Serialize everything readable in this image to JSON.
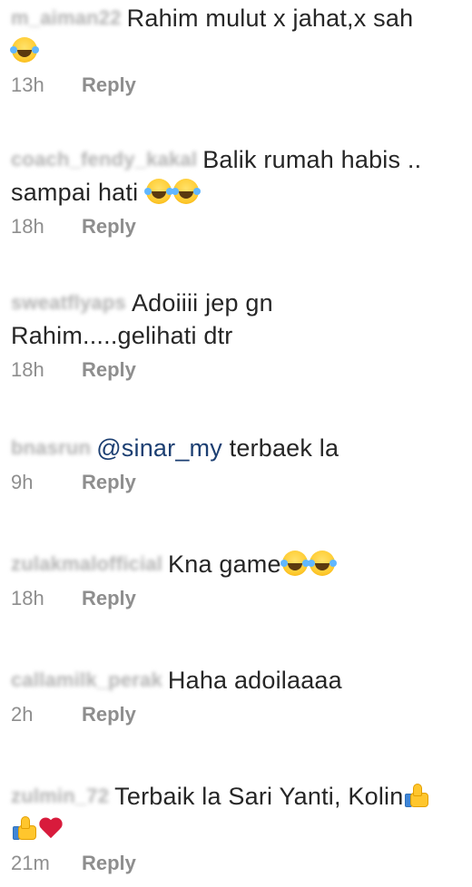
{
  "comments": [
    {
      "username": "m_aiman22",
      "text": "Rahim mulut x jahat,x sah",
      "time": "13h",
      "reply": "Reply"
    },
    {
      "username": "coach_fendy_kakal",
      "text_line1": "Balik rumah habis ..",
      "text_line2": "sampai hati",
      "time": "18h",
      "reply": "Reply"
    },
    {
      "username": "sweatflyaps",
      "text_line1": "Adoiiii jep gn",
      "text_line2": "Rahim.....gelihati dtr",
      "time": "18h",
      "reply": "Reply"
    },
    {
      "username": "bnasrun",
      "mention": "@sinar_my",
      "text": "terbaek la",
      "time": "9h",
      "reply": "Reply"
    },
    {
      "username": "zulakmalofficial",
      "text": "Kna game",
      "time": "18h",
      "reply": "Reply"
    },
    {
      "username": "callamilk_perak",
      "text": "Haha adoilaaaa",
      "time": "2h",
      "reply": "Reply"
    },
    {
      "username": "zulmin_72",
      "text": "Terbaik la Sari Yanti, Kolin",
      "time": "21m",
      "reply": "Reply"
    }
  ]
}
